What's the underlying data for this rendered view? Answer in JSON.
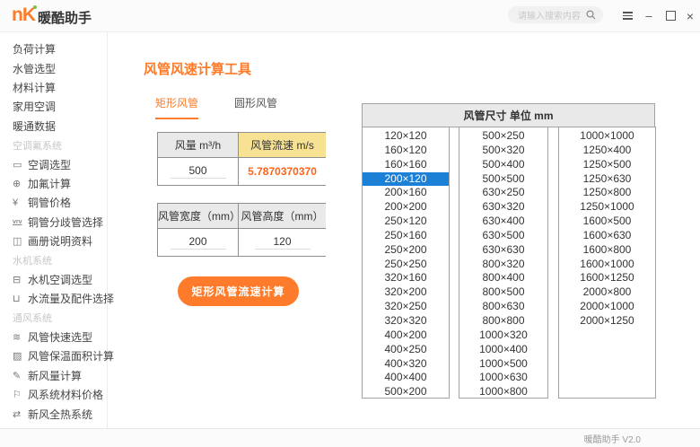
{
  "window": {
    "logo_mark": "nK",
    "logo_text": "暖酷助手",
    "search_placeholder": "请输入搜索内容",
    "controls": [
      {
        "name": "menu-icon"
      },
      {
        "name": "minimize-icon"
      },
      {
        "name": "maximize-icon"
      },
      {
        "name": "close-icon"
      }
    ],
    "footer_version": "暖酷助手 V2.0"
  },
  "colors": {
    "accent_orange": "#fd7b2a",
    "velocity_orange": "#ff6317",
    "selected_blue": "#1d80d7",
    "header_yellow": "#f6e292",
    "header_gray": "#e9e9e9"
  },
  "sidebar": {
    "top_items": [
      "负荷计算",
      "水管选型",
      "材料计算",
      "家用空调",
      "暖通数据"
    ],
    "groups": [
      {
        "header": "空调氟系统",
        "items": [
          {
            "icon": "ac-select-icon",
            "glyph": "▭",
            "label": "空调选型"
          },
          {
            "icon": "refrigerant-calc-icon",
            "glyph": "⊕",
            "label": "加氟计算"
          },
          {
            "icon": "copper-price-icon",
            "glyph": "¥",
            "label": "铜管价格"
          },
          {
            "icon": "vrv-branch-icon",
            "glyph": "vrv",
            "label": "铜管分歧管选择"
          },
          {
            "icon": "catalog-docs-icon",
            "glyph": "◫",
            "label": "画册说明资料"
          }
        ]
      },
      {
        "header": "水机系统",
        "items": [
          {
            "icon": "water-ac-select-icon",
            "glyph": "⊟",
            "label": "水机空调选型"
          },
          {
            "icon": "water-flow-fittings-icon",
            "glyph": "⊔",
            "label": "水流量及配件选择"
          }
        ]
      },
      {
        "header": "通风系统",
        "items": [
          {
            "icon": "duct-quick-select-icon",
            "glyph": "≋",
            "label": "风管快速选型"
          },
          {
            "icon": "duct-insulation-area-icon",
            "glyph": "▨",
            "label": "风管保温面积计算"
          },
          {
            "icon": "fresh-air-calc-icon",
            "glyph": "✎",
            "label": "新风量计算"
          },
          {
            "icon": "duct-material-price-icon",
            "glyph": "⚐",
            "label": "风系统材料价格"
          },
          {
            "icon": "erv-system-icon",
            "glyph": "⇄",
            "label": "新风全热系统"
          }
        ]
      }
    ]
  },
  "main": {
    "title": "风管风速计算工具",
    "tabs": [
      {
        "label": "矩形风管",
        "active": true
      },
      {
        "label": "圆形风管",
        "active": false
      }
    ],
    "flow_table": {
      "headers": [
        "风量 m³/h",
        "风管流速 m/s"
      ],
      "flow_value": "500",
      "velocity_value": "5.7870370370"
    },
    "size_table": {
      "headers": [
        "风管宽度（mm）",
        "风管高度（mm）"
      ],
      "width_value": "200",
      "height_value": "120"
    },
    "calc_button": "矩形风管流速计算"
  },
  "duct_panel": {
    "header": "风管尺寸 单位 mm",
    "selected": "200×120",
    "columns": [
      [
        "120×120",
        "160×120",
        "160×160",
        "200×120",
        "200×160",
        "200×200",
        "250×120",
        "250×160",
        "250×200",
        "250×250",
        "320×160",
        "320×200",
        "320×250",
        "320×320",
        "400×200",
        "400×250",
        "400×320",
        "400×400",
        "500×200"
      ],
      [
        "500×250",
        "500×320",
        "500×400",
        "500×500",
        "630×250",
        "630×320",
        "630×400",
        "630×500",
        "630×630",
        "800×320",
        "800×400",
        "800×500",
        "800×630",
        "800×800",
        "1000×320",
        "1000×400",
        "1000×500",
        "1000×630",
        "1000×800"
      ],
      [
        "1000×1000",
        "1250×400",
        "1250×500",
        "1250×630",
        "1250×800",
        "1250×1000",
        "1600×500",
        "1600×630",
        "1600×800",
        "1600×1000",
        "1600×1250",
        "2000×800",
        "2000×1000",
        "2000×1250"
      ]
    ]
  }
}
